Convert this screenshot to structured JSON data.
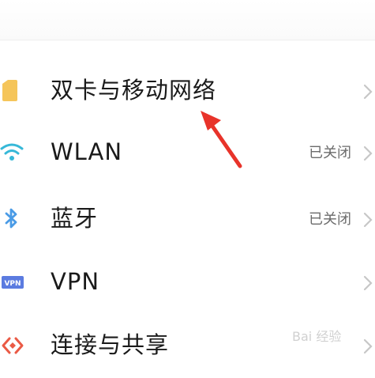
{
  "settings": {
    "items": [
      {
        "label": "双卡与移动网络",
        "status": "",
        "icon": "sim-card-icon"
      },
      {
        "label": "WLAN",
        "status": "已关闭",
        "icon": "wifi-icon"
      },
      {
        "label": "蓝牙",
        "status": "已关闭",
        "icon": "bluetooth-icon"
      },
      {
        "label": "VPN",
        "status": "",
        "icon": "vpn-icon",
        "icon_text": "VPN"
      },
      {
        "label": "连接与共享",
        "status": "",
        "icon": "share-icon"
      }
    ]
  },
  "colors": {
    "sim_icon": "#f5c55a",
    "wifi_icon": "#36b8d8",
    "bluetooth_icon": "#4a9be6",
    "vpn_icon": "#5b7be0",
    "share_icon": "#ea5a45",
    "arrow": "#e8332a",
    "chevron": "#c7c7c7"
  },
  "watermark": "Bai 经验"
}
